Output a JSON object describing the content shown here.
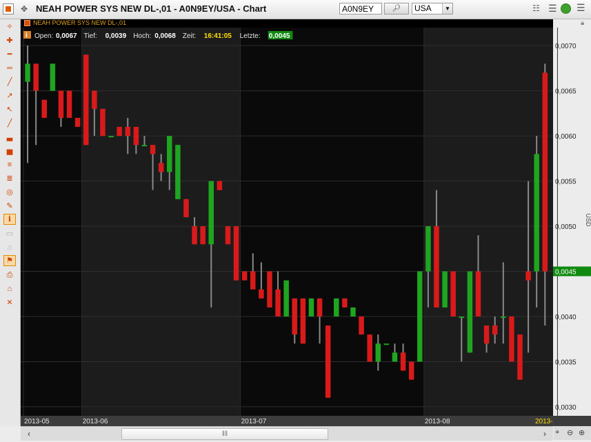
{
  "window": {
    "title": "NEAH POWER SYS NEW DL-,01 - A0N9EY/USA - Chart",
    "symbol_value": "A0N9EY",
    "exchange_value": "USA"
  },
  "legend": {
    "instrument": "NEAH POWER SYS NEW DL-,01",
    "open_label": "Open:",
    "open_value": "0,0067",
    "low_label": "Tief:",
    "low_value": "0,0039",
    "high_label": "Hoch:",
    "high_value": "0,0068",
    "time_label": "Zeit:",
    "time_value": "16:41:05",
    "last_label": "Letzte:",
    "last_value": "0,0045",
    "info_icon": "info-icon"
  },
  "colors": {
    "up": "#1fa51f",
    "down": "#d91a1a",
    "wick": "#8a8a8a",
    "background": "#0a0a0a",
    "band": "#1c1c1c",
    "last_price": "#118a11",
    "highlight_text": "#ffe000"
  },
  "chart_data": {
    "type": "candlestick",
    "title": "",
    "ylabel": "USD",
    "ylim": [
      0.0029,
      0.0072
    ],
    "yticks": [
      "0,0030",
      "0,0035",
      "0,0040",
      "0,0045",
      "0,0050",
      "0,0055",
      "0,0060",
      "0,0065",
      "0,0070"
    ],
    "ytick_values": [
      0.003,
      0.0035,
      0.004,
      0.0045,
      0.005,
      0.0055,
      0.006,
      0.0065,
      0.007
    ],
    "x_labels": [
      {
        "label": "2013-05",
        "index": 0
      },
      {
        "label": "2013-06",
        "index": 7
      },
      {
        "label": "2013-07",
        "index": 26
      },
      {
        "label": "2013-08",
        "index": 48
      },
      {
        "label": "2013-",
        "index": 64
      }
    ],
    "month_bands_shaded": [
      [
        7,
        25
      ],
      [
        48,
        64
      ]
    ],
    "last_price": 0.0045,
    "last_price_label": "0,0045",
    "candles": [
      {
        "o": 0.0066,
        "h": 0.007,
        "l": 0.0057,
        "c": 0.0068
      },
      {
        "o": 0.0068,
        "h": 0.0068,
        "l": 0.0059,
        "c": 0.0065
      },
      {
        "o": 0.0064,
        "h": 0.0064,
        "l": 0.0062,
        "c": 0.0062
      },
      {
        "o": 0.0065,
        "h": 0.0068,
        "l": 0.0065,
        "c": 0.0068
      },
      {
        "o": 0.0065,
        "h": 0.0065,
        "l": 0.0061,
        "c": 0.0062
      },
      {
        "o": 0.0065,
        "h": 0.0065,
        "l": 0.0062,
        "c": 0.0062
      },
      {
        "o": 0.0062,
        "h": 0.0062,
        "l": 0.0061,
        "c": 0.0061
      },
      {
        "o": 0.0069,
        "h": 0.0069,
        "l": 0.0059,
        "c": 0.0059
      },
      {
        "o": 0.0065,
        "h": 0.0065,
        "l": 0.006,
        "c": 0.0063
      },
      {
        "o": 0.0063,
        "h": 0.0063,
        "l": 0.006,
        "c": 0.006
      },
      {
        "o": 0.006,
        "h": 0.006,
        "l": 0.006,
        "c": 0.006
      },
      {
        "o": 0.0061,
        "h": 0.0061,
        "l": 0.006,
        "c": 0.006
      },
      {
        "o": 0.0061,
        "h": 0.0062,
        "l": 0.0058,
        "c": 0.006
      },
      {
        "o": 0.0061,
        "h": 0.0061,
        "l": 0.0058,
        "c": 0.0059
      },
      {
        "o": 0.0059,
        "h": 0.006,
        "l": 0.0059,
        "c": 0.0059
      },
      {
        "o": 0.0059,
        "h": 0.0059,
        "l": 0.0054,
        "c": 0.0058
      },
      {
        "o": 0.0057,
        "h": 0.0058,
        "l": 0.0055,
        "c": 0.0056
      },
      {
        "o": 0.0056,
        "h": 0.006,
        "l": 0.0054,
        "c": 0.006
      },
      {
        "o": 0.0053,
        "h": 0.0059,
        "l": 0.0053,
        "c": 0.0059
      },
      {
        "o": 0.0053,
        "h": 0.0053,
        "l": 0.0051,
        "c": 0.0051
      },
      {
        "o": 0.005,
        "h": 0.0051,
        "l": 0.0048,
        "c": 0.0048
      },
      {
        "o": 0.005,
        "h": 0.005,
        "l": 0.0048,
        "c": 0.0048
      },
      {
        "o": 0.0048,
        "h": 0.0055,
        "l": 0.0041,
        "c": 0.0055
      },
      {
        "o": 0.0055,
        "h": 0.0055,
        "l": 0.0054,
        "c": 0.0054
      },
      {
        "o": 0.005,
        "h": 0.005,
        "l": 0.0048,
        "c": 0.0048
      },
      {
        "o": 0.005,
        "h": 0.005,
        "l": 0.0044,
        "c": 0.0044
      },
      {
        "o": 0.0045,
        "h": 0.0045,
        "l": 0.0044,
        "c": 0.0044
      },
      {
        "o": 0.0045,
        "h": 0.0047,
        "l": 0.0044,
        "c": 0.0043
      },
      {
        "o": 0.0043,
        "h": 0.0046,
        "l": 0.0043,
        "c": 0.0042
      },
      {
        "o": 0.0045,
        "h": 0.0045,
        "l": 0.0041,
        "c": 0.0041
      },
      {
        "o": 0.0043,
        "h": 0.0045,
        "l": 0.004,
        "c": 0.004
      },
      {
        "o": 0.004,
        "h": 0.0044,
        "l": 0.004,
        "c": 0.0044
      },
      {
        "o": 0.0042,
        "h": 0.0042,
        "l": 0.0037,
        "c": 0.0038
      },
      {
        "o": 0.0042,
        "h": 0.0042,
        "l": 0.0037,
        "c": 0.0037
      },
      {
        "o": 0.004,
        "h": 0.0042,
        "l": 0.004,
        "c": 0.0042
      },
      {
        "o": 0.0042,
        "h": 0.0042,
        "l": 0.0037,
        "c": 0.004
      },
      {
        "o": 0.0039,
        "h": 0.0039,
        "l": 0.0031,
        "c": 0.0031
      },
      {
        "o": 0.004,
        "h": 0.0042,
        "l": 0.004,
        "c": 0.0042
      },
      {
        "o": 0.0042,
        "h": 0.0042,
        "l": 0.0041,
        "c": 0.0041
      },
      {
        "o": 0.004,
        "h": 0.0041,
        "l": 0.004,
        "c": 0.0041
      },
      {
        "o": 0.004,
        "h": 0.004,
        "l": 0.0038,
        "c": 0.0038
      },
      {
        "o": 0.0038,
        "h": 0.0038,
        "l": 0.0035,
        "c": 0.0035
      },
      {
        "o": 0.0035,
        "h": 0.0038,
        "l": 0.0034,
        "c": 0.0037
      },
      {
        "o": 0.0037,
        "h": 0.0037,
        "l": 0.0037,
        "c": 0.0037
      },
      {
        "o": 0.0035,
        "h": 0.0037,
        "l": 0.0035,
        "c": 0.0036
      },
      {
        "o": 0.0036,
        "h": 0.0037,
        "l": 0.0034,
        "c": 0.0034
      },
      {
        "o": 0.0035,
        "h": 0.0035,
        "l": 0.0033,
        "c": 0.0033
      },
      {
        "o": 0.0035,
        "h": 0.0045,
        "l": 0.0035,
        "c": 0.0045
      },
      {
        "o": 0.0045,
        "h": 0.005,
        "l": 0.0041,
        "c": 0.005
      },
      {
        "o": 0.005,
        "h": 0.0054,
        "l": 0.0041,
        "c": 0.0041
      },
      {
        "o": 0.0041,
        "h": 0.0045,
        "l": 0.0041,
        "c": 0.0045
      },
      {
        "o": 0.0045,
        "h": 0.0045,
        "l": 0.004,
        "c": 0.004
      },
      {
        "o": 0.004,
        "h": 0.004,
        "l": 0.0035,
        "c": 0.004
      },
      {
        "o": 0.0036,
        "h": 0.0045,
        "l": 0.0036,
        "c": 0.0045
      },
      {
        "o": 0.0045,
        "h": 0.0049,
        "l": 0.004,
        "c": 0.004
      },
      {
        "o": 0.0039,
        "h": 0.0039,
        "l": 0.0036,
        "c": 0.0037
      },
      {
        "o": 0.0039,
        "h": 0.004,
        "l": 0.0037,
        "c": 0.0038
      },
      {
        "o": 0.004,
        "h": 0.0046,
        "l": 0.0037,
        "c": 0.004
      },
      {
        "o": 0.004,
        "h": 0.004,
        "l": 0.0035,
        "c": 0.0035
      },
      {
        "o": 0.0038,
        "h": 0.0038,
        "l": 0.0033,
        "c": 0.0033
      },
      {
        "o": 0.0045,
        "h": 0.0055,
        "l": 0.0036,
        "c": 0.0044
      },
      {
        "o": 0.0045,
        "h": 0.006,
        "l": 0.0041,
        "c": 0.0058
      },
      {
        "o": 0.0067,
        "h": 0.0068,
        "l": 0.0039,
        "c": 0.0045
      }
    ]
  }
}
